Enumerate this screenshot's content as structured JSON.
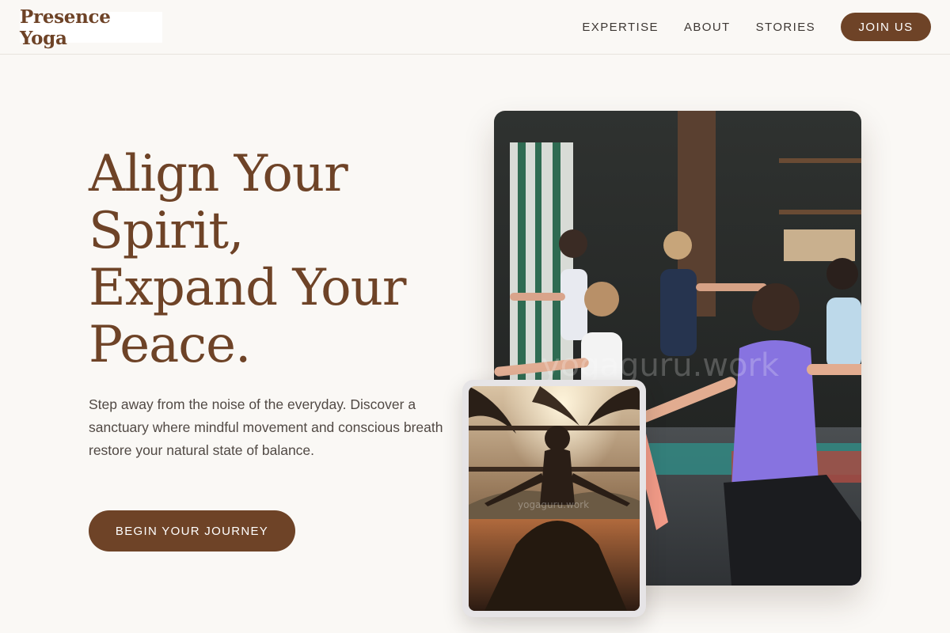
{
  "brand": {
    "name": "Presence Yoga"
  },
  "nav": {
    "links": [
      "EXPERTISE",
      "ABOUT",
      "STORIES"
    ],
    "cta_label": "JOIN US"
  },
  "hero": {
    "title_lines": [
      "Align Your",
      "Spirit,",
      "Expand Your",
      "Peace."
    ],
    "description": "Step away from the noise of the everyday. Discover a sanctuary where mindful movement and conscious breath restore your natural state of balance.",
    "cta_label": "BEGIN YOUR JOURNEY"
  },
  "images": {
    "main": {
      "subject": "yoga class warrior pose",
      "watermark": "yogaguru.work"
    },
    "secondary": {
      "subject": "meditation silhouette at sunset",
      "watermark": "yogaguru.work"
    }
  },
  "colors": {
    "brand_brown": "#6e4327",
    "background": "#faf8f5",
    "body_text": "#514944"
  }
}
